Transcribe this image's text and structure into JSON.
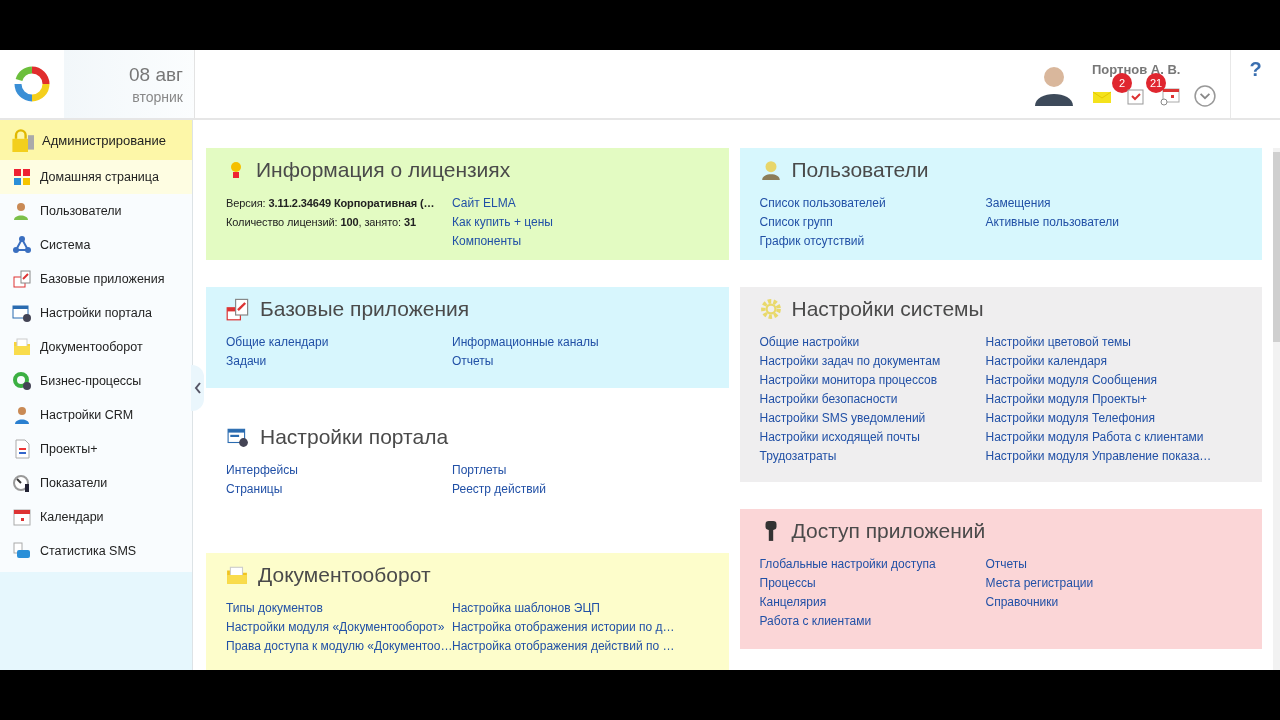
{
  "header": {
    "date": "08 авг",
    "weekday": "вторник",
    "user_name": "Портнов А. В.",
    "messages_badge": "2",
    "tasks_badge": "21",
    "help": "?"
  },
  "sidebar": {
    "title": "Администрирование",
    "items": [
      {
        "label": "Домашняя страница",
        "selected": true
      },
      {
        "label": "Пользователи",
        "selected": false
      },
      {
        "label": "Система",
        "selected": false
      },
      {
        "label": "Базовые приложения",
        "selected": false
      },
      {
        "label": "Настройки портала",
        "selected": false
      },
      {
        "label": "Документооборот",
        "selected": false
      },
      {
        "label": "Бизнес-процессы",
        "selected": false
      },
      {
        "label": "Настройки CRM",
        "selected": false
      },
      {
        "label": "Проекты+",
        "selected": false
      },
      {
        "label": "Показатели",
        "selected": false
      },
      {
        "label": "Календари",
        "selected": false
      },
      {
        "label": "Статистика SMS",
        "selected": false
      }
    ]
  },
  "left_cards": [
    {
      "title": "Информация о лицензиях",
      "color": "#e3fbc2",
      "columns": [
        [
          {
            "kind": "text",
            "text": "Версия: **3.11.2.34649 Корпоративная (…**"
          },
          {
            "kind": "text",
            "text": "Количество лицензий: **100**, занято: **31**"
          }
        ],
        [
          {
            "kind": "link",
            "text": "Сайт ELMA"
          },
          {
            "kind": "link",
            "text": "Как купить + цены"
          },
          {
            "kind": "link",
            "text": "Компоненты"
          }
        ]
      ]
    },
    {
      "title": "Базовые приложения",
      "color": "#d7f6fd",
      "columns": [
        [
          {
            "kind": "link",
            "text": "Общие календари"
          },
          {
            "kind": "link",
            "text": "Задачи"
          }
        ],
        [
          {
            "kind": "link",
            "text": "Информационные каналы"
          },
          {
            "kind": "link",
            "text": "Отчеты"
          }
        ]
      ]
    },
    {
      "title": "Настройки портала",
      "color": "#ffffff",
      "columns": [
        [
          {
            "kind": "link",
            "text": "Интерфейсы"
          },
          {
            "kind": "link",
            "text": "Страницы"
          }
        ],
        [
          {
            "kind": "link",
            "text": "Портлеты"
          },
          {
            "kind": "link",
            "text": "Реестр действий"
          }
        ]
      ]
    },
    {
      "title": "Документооборот",
      "color": "#fdfdcb",
      "columns": [
        [
          {
            "kind": "link",
            "text": "Типы документов"
          },
          {
            "kind": "link",
            "text": "Настройки модуля «Документооборот»"
          },
          {
            "kind": "link",
            "text": "Права доступа к модулю «Документоо…"
          }
        ],
        [
          {
            "kind": "link",
            "text": "Настройка шаблонов ЭЦП"
          },
          {
            "kind": "link",
            "text": "Настройка отображения истории по д…"
          },
          {
            "kind": "link",
            "text": "Настройка отображения действий по …"
          }
        ]
      ]
    }
  ],
  "right_cards": [
    {
      "title": "Пользователи",
      "color": "#d7f7fd",
      "columns": [
        [
          {
            "kind": "link",
            "text": "Список пользователей"
          },
          {
            "kind": "link",
            "text": "Список групп"
          },
          {
            "kind": "link",
            "text": "График отсутствий"
          }
        ],
        [
          {
            "kind": "link",
            "text": "Замещения"
          },
          {
            "kind": "link",
            "text": "Активные пользователи"
          }
        ]
      ]
    },
    {
      "title": "Настройки системы",
      "color": "#efeeef",
      "columns": [
        [
          {
            "kind": "link",
            "text": "Общие настройки"
          },
          {
            "kind": "link",
            "text": "Настройки задач по документам"
          },
          {
            "kind": "link",
            "text": "Настройки монитора процессов"
          },
          {
            "kind": "link",
            "text": "Настройки безопасности"
          },
          {
            "kind": "link",
            "text": "Настройки SMS уведомлений"
          },
          {
            "kind": "link",
            "text": "Настройки исходящей почты"
          },
          {
            "kind": "link",
            "text": "Трудозатраты"
          }
        ],
        [
          {
            "kind": "link",
            "text": "Настройки цветовой темы"
          },
          {
            "kind": "link",
            "text": "Настройки календаря"
          },
          {
            "kind": "link",
            "text": "Настройки модуля Сообщения"
          },
          {
            "kind": "link",
            "text": "Настройки модуля Проекты+"
          },
          {
            "kind": "link",
            "text": "Настройки модуля Телефония"
          },
          {
            "kind": "link",
            "text": "Настройки модуля Работа с клиентами"
          },
          {
            "kind": "link",
            "text": "Настройки модуля Управление показа…"
          }
        ]
      ]
    },
    {
      "title": "Доступ приложений",
      "color": "#fbd6d7",
      "columns": [
        [
          {
            "kind": "link",
            "text": "Глобальные настройки доступа"
          },
          {
            "kind": "link",
            "text": "Процессы"
          },
          {
            "kind": "link",
            "text": "Канцелярия"
          },
          {
            "kind": "link",
            "text": "Работа с клиентами"
          }
        ],
        [
          {
            "kind": "link",
            "text": "Отчеты"
          },
          {
            "kind": "link",
            "text": "Места регистрации"
          },
          {
            "kind": "link",
            "text": "Справочники"
          }
        ]
      ]
    }
  ]
}
